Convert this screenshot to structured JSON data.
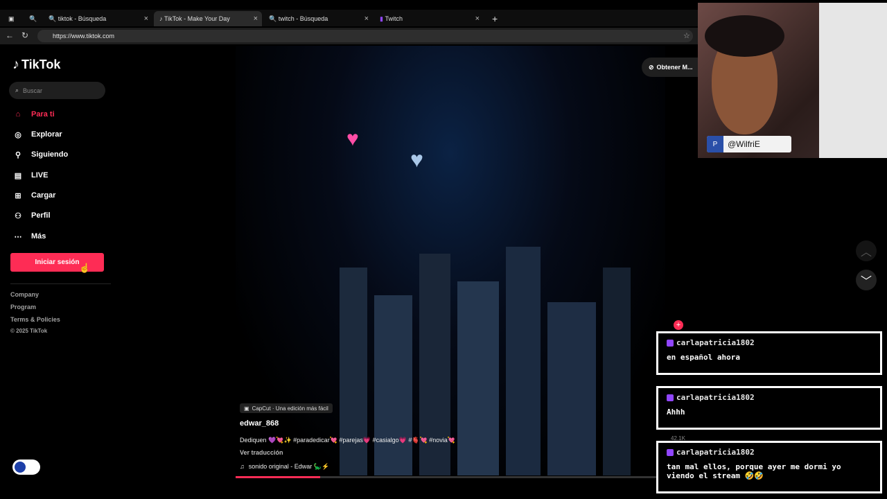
{
  "browser": {
    "tabs": [
      {
        "label": ""
      },
      {
        "label": "tiktok - Búsqueda"
      },
      {
        "label": "TikTok - Make Your Day"
      },
      {
        "label": "twitch - Búsqueda"
      },
      {
        "label": "Twitch"
      }
    ],
    "url": "https://www.tiktok.com"
  },
  "sidebar": {
    "logo": "TikTok",
    "search_placeholder": "Buscar",
    "items": [
      {
        "label": "Para ti",
        "icon": "home-icon"
      },
      {
        "label": "Explorar",
        "icon": "compass-icon"
      },
      {
        "label": "Siguiendo",
        "icon": "follow-icon"
      },
      {
        "label": "LIVE",
        "icon": "live-icon"
      },
      {
        "label": "Cargar",
        "icon": "upload-icon"
      },
      {
        "label": "Perfil",
        "icon": "profile-icon"
      },
      {
        "label": "Más",
        "icon": "more-icon"
      }
    ],
    "login": "Iniciar sesión",
    "footer": [
      "Company",
      "Program",
      "Terms & Policies",
      "© 2025 TikTok"
    ]
  },
  "header": {
    "get_app": "Obtener M..."
  },
  "video": {
    "capcut": "CapCut · Una edición más fácil",
    "author": "edwar_868",
    "caption": "Dediquen 💜💘✨ #paradedicar💘 #parejas💗 #casialgo💗 #🫀💘 #novia💘",
    "translate": "Ver traducción",
    "sound": "sonido original - Edwar 🦕⚡",
    "progress": 0.2,
    "side_count": "42.1K"
  },
  "overlay": {
    "streamer": "@WilfriE",
    "chat": [
      {
        "user": "carlapatricia1802",
        "message": "en español ahora"
      },
      {
        "user": "carlapatricia1802",
        "message": "Ahhh"
      },
      {
        "user": "carlapatricia1802",
        "message": "tan mal ellos, porque ayer me dormi yo viendo el stream 🤣🤣"
      }
    ]
  },
  "colors": {
    "accent": "#fe2c55",
    "twitch": "#9146ff"
  }
}
